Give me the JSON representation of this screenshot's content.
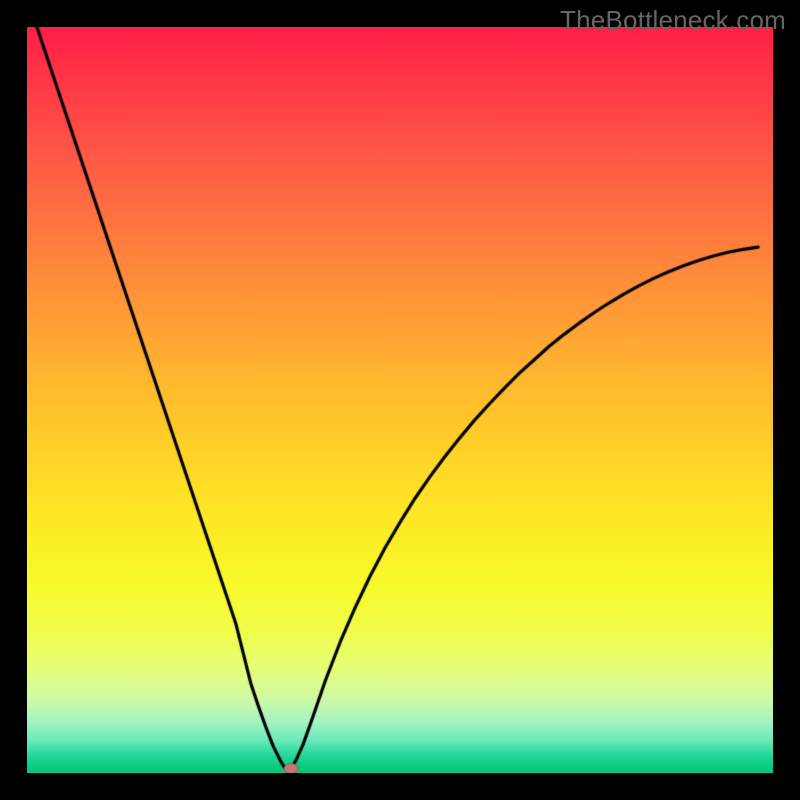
{
  "watermark": "TheBottleneck.com",
  "colors": {
    "curve": "#000000",
    "border": "#000000",
    "marker_fill": "#c9776e",
    "marker_stroke": "#9e5a52"
  },
  "chart_data": {
    "type": "line",
    "title": "",
    "xlabel": "",
    "ylabel": "",
    "xlim": [
      0,
      100
    ],
    "ylim": [
      0,
      100
    ],
    "notes": "V-shaped bottleneck curve; y ≈ 100 at x=0, dips to ≈0 near x≈35, rises to ≈70 at x=100. Background is a red→yellow→green vertical gradient.",
    "x": [
      0,
      2,
      4,
      6,
      8,
      10,
      12,
      14,
      16,
      18,
      20,
      22,
      24,
      26,
      28,
      30,
      31,
      32,
      33,
      34,
      34.5,
      35,
      35.5,
      36,
      37,
      38,
      40,
      42,
      44,
      46,
      48,
      50,
      52,
      54,
      56,
      58,
      60,
      62,
      64,
      66,
      68,
      70,
      72,
      74,
      76,
      78,
      80,
      82,
      84,
      86,
      88,
      90,
      92,
      94,
      96,
      98,
      100
    ],
    "y": [
      104,
      98,
      92,
      86,
      80,
      74,
      68,
      62,
      56,
      50,
      44,
      38,
      32,
      26,
      20,
      12,
      9,
      6.2,
      3.6,
      1.6,
      0.8,
      0.3,
      0.8,
      1.6,
      3.8,
      6.6,
      12.4,
      17.6,
      22.2,
      26.4,
      30.2,
      33.6,
      36.8,
      39.7,
      42.4,
      44.9,
      47.3,
      49.5,
      51.6,
      53.6,
      55.4,
      57.2,
      58.8,
      60.3,
      61.7,
      63.0,
      64.2,
      65.3,
      66.3,
      67.2,
      68.0,
      68.7,
      69.3,
      69.8,
      70.2,
      70.5
    ],
    "marker": {
      "x": 35.4,
      "y": 0.6,
      "rx": 7,
      "ry": 5
    }
  }
}
